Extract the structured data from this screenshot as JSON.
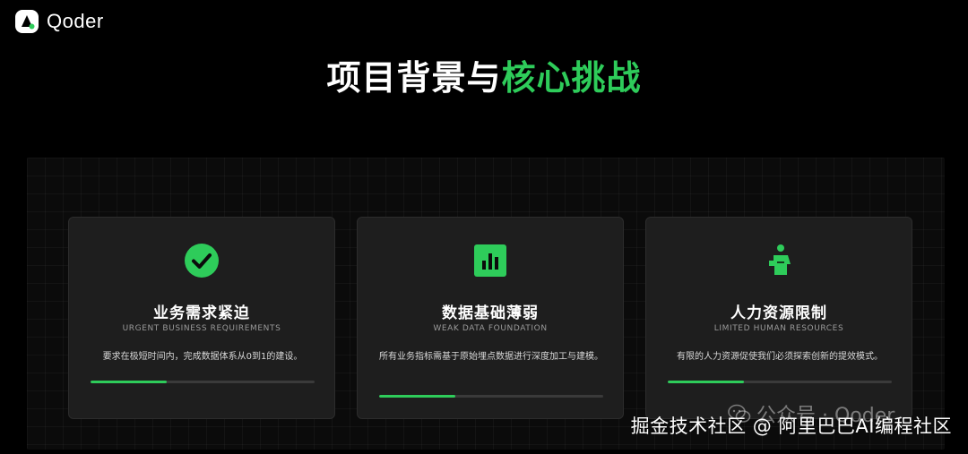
{
  "brand": {
    "logo_text": "Qoder"
  },
  "title": {
    "part_white": "项目背景与",
    "part_green": "核心挑战"
  },
  "colors": {
    "accent": "#2ecc5a",
    "background": "#000000",
    "card": "#1e1e1e"
  },
  "cards": [
    {
      "icon": "check-circle-icon",
      "title": "业务需求紧迫",
      "subtitle": "URGENT BUSINESS REQUIREMENTS",
      "description": "要求在极短时间内，完成数据体系从0到1的建设。",
      "progress": 0.34
    },
    {
      "icon": "bar-chart-icon",
      "title": "数据基础薄弱",
      "subtitle": "WEAK DATA FOUNDATION",
      "description": "所有业务指标需基于原始埋点数据进行深度加工与建模。",
      "progress": 0.34
    },
    {
      "icon": "person-icon",
      "title": "人力资源限制",
      "subtitle": "LIMITED HUMAN RESOURCES",
      "description": "有限的人力资源促使我们必须探索创新的提效模式。",
      "progress": 0.34
    }
  ],
  "watermarks": {
    "official_account": "公众号 · Qoder",
    "juejin": "掘金技术社区 @ 阿里巴巴AI编程社区"
  }
}
